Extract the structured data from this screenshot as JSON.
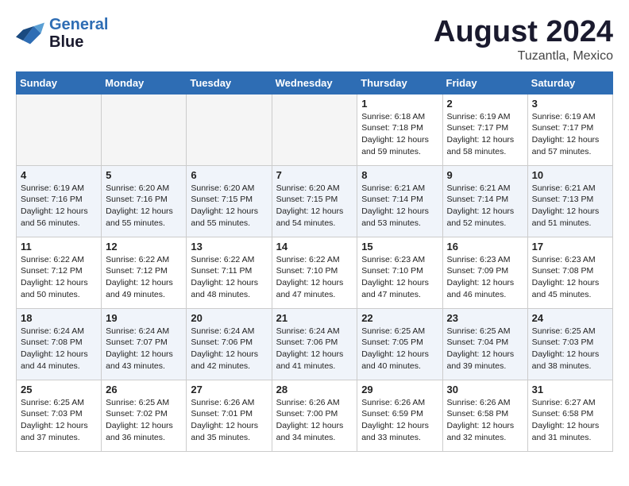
{
  "header": {
    "logo_line1": "General",
    "logo_line2": "Blue",
    "month": "August 2024",
    "location": "Tuzantla, Mexico"
  },
  "weekdays": [
    "Sunday",
    "Monday",
    "Tuesday",
    "Wednesday",
    "Thursday",
    "Friday",
    "Saturday"
  ],
  "weeks": [
    [
      {
        "day": "",
        "info": ""
      },
      {
        "day": "",
        "info": ""
      },
      {
        "day": "",
        "info": ""
      },
      {
        "day": "",
        "info": ""
      },
      {
        "day": "1",
        "info": "Sunrise: 6:18 AM\nSunset: 7:18 PM\nDaylight: 12 hours\nand 59 minutes."
      },
      {
        "day": "2",
        "info": "Sunrise: 6:19 AM\nSunset: 7:17 PM\nDaylight: 12 hours\nand 58 minutes."
      },
      {
        "day": "3",
        "info": "Sunrise: 6:19 AM\nSunset: 7:17 PM\nDaylight: 12 hours\nand 57 minutes."
      }
    ],
    [
      {
        "day": "4",
        "info": "Sunrise: 6:19 AM\nSunset: 7:16 PM\nDaylight: 12 hours\nand 56 minutes."
      },
      {
        "day": "5",
        "info": "Sunrise: 6:20 AM\nSunset: 7:16 PM\nDaylight: 12 hours\nand 55 minutes."
      },
      {
        "day": "6",
        "info": "Sunrise: 6:20 AM\nSunset: 7:15 PM\nDaylight: 12 hours\nand 55 minutes."
      },
      {
        "day": "7",
        "info": "Sunrise: 6:20 AM\nSunset: 7:15 PM\nDaylight: 12 hours\nand 54 minutes."
      },
      {
        "day": "8",
        "info": "Sunrise: 6:21 AM\nSunset: 7:14 PM\nDaylight: 12 hours\nand 53 minutes."
      },
      {
        "day": "9",
        "info": "Sunrise: 6:21 AM\nSunset: 7:14 PM\nDaylight: 12 hours\nand 52 minutes."
      },
      {
        "day": "10",
        "info": "Sunrise: 6:21 AM\nSunset: 7:13 PM\nDaylight: 12 hours\nand 51 minutes."
      }
    ],
    [
      {
        "day": "11",
        "info": "Sunrise: 6:22 AM\nSunset: 7:12 PM\nDaylight: 12 hours\nand 50 minutes."
      },
      {
        "day": "12",
        "info": "Sunrise: 6:22 AM\nSunset: 7:12 PM\nDaylight: 12 hours\nand 49 minutes."
      },
      {
        "day": "13",
        "info": "Sunrise: 6:22 AM\nSunset: 7:11 PM\nDaylight: 12 hours\nand 48 minutes."
      },
      {
        "day": "14",
        "info": "Sunrise: 6:22 AM\nSunset: 7:10 PM\nDaylight: 12 hours\nand 47 minutes."
      },
      {
        "day": "15",
        "info": "Sunrise: 6:23 AM\nSunset: 7:10 PM\nDaylight: 12 hours\nand 47 minutes."
      },
      {
        "day": "16",
        "info": "Sunrise: 6:23 AM\nSunset: 7:09 PM\nDaylight: 12 hours\nand 46 minutes."
      },
      {
        "day": "17",
        "info": "Sunrise: 6:23 AM\nSunset: 7:08 PM\nDaylight: 12 hours\nand 45 minutes."
      }
    ],
    [
      {
        "day": "18",
        "info": "Sunrise: 6:24 AM\nSunset: 7:08 PM\nDaylight: 12 hours\nand 44 minutes."
      },
      {
        "day": "19",
        "info": "Sunrise: 6:24 AM\nSunset: 7:07 PM\nDaylight: 12 hours\nand 43 minutes."
      },
      {
        "day": "20",
        "info": "Sunrise: 6:24 AM\nSunset: 7:06 PM\nDaylight: 12 hours\nand 42 minutes."
      },
      {
        "day": "21",
        "info": "Sunrise: 6:24 AM\nSunset: 7:06 PM\nDaylight: 12 hours\nand 41 minutes."
      },
      {
        "day": "22",
        "info": "Sunrise: 6:25 AM\nSunset: 7:05 PM\nDaylight: 12 hours\nand 40 minutes."
      },
      {
        "day": "23",
        "info": "Sunrise: 6:25 AM\nSunset: 7:04 PM\nDaylight: 12 hours\nand 39 minutes."
      },
      {
        "day": "24",
        "info": "Sunrise: 6:25 AM\nSunset: 7:03 PM\nDaylight: 12 hours\nand 38 minutes."
      }
    ],
    [
      {
        "day": "25",
        "info": "Sunrise: 6:25 AM\nSunset: 7:03 PM\nDaylight: 12 hours\nand 37 minutes."
      },
      {
        "day": "26",
        "info": "Sunrise: 6:25 AM\nSunset: 7:02 PM\nDaylight: 12 hours\nand 36 minutes."
      },
      {
        "day": "27",
        "info": "Sunrise: 6:26 AM\nSunset: 7:01 PM\nDaylight: 12 hours\nand 35 minutes."
      },
      {
        "day": "28",
        "info": "Sunrise: 6:26 AM\nSunset: 7:00 PM\nDaylight: 12 hours\nand 34 minutes."
      },
      {
        "day": "29",
        "info": "Sunrise: 6:26 AM\nSunset: 6:59 PM\nDaylight: 12 hours\nand 33 minutes."
      },
      {
        "day": "30",
        "info": "Sunrise: 6:26 AM\nSunset: 6:58 PM\nDaylight: 12 hours\nand 32 minutes."
      },
      {
        "day": "31",
        "info": "Sunrise: 6:27 AM\nSunset: 6:58 PM\nDaylight: 12 hours\nand 31 minutes."
      }
    ]
  ]
}
